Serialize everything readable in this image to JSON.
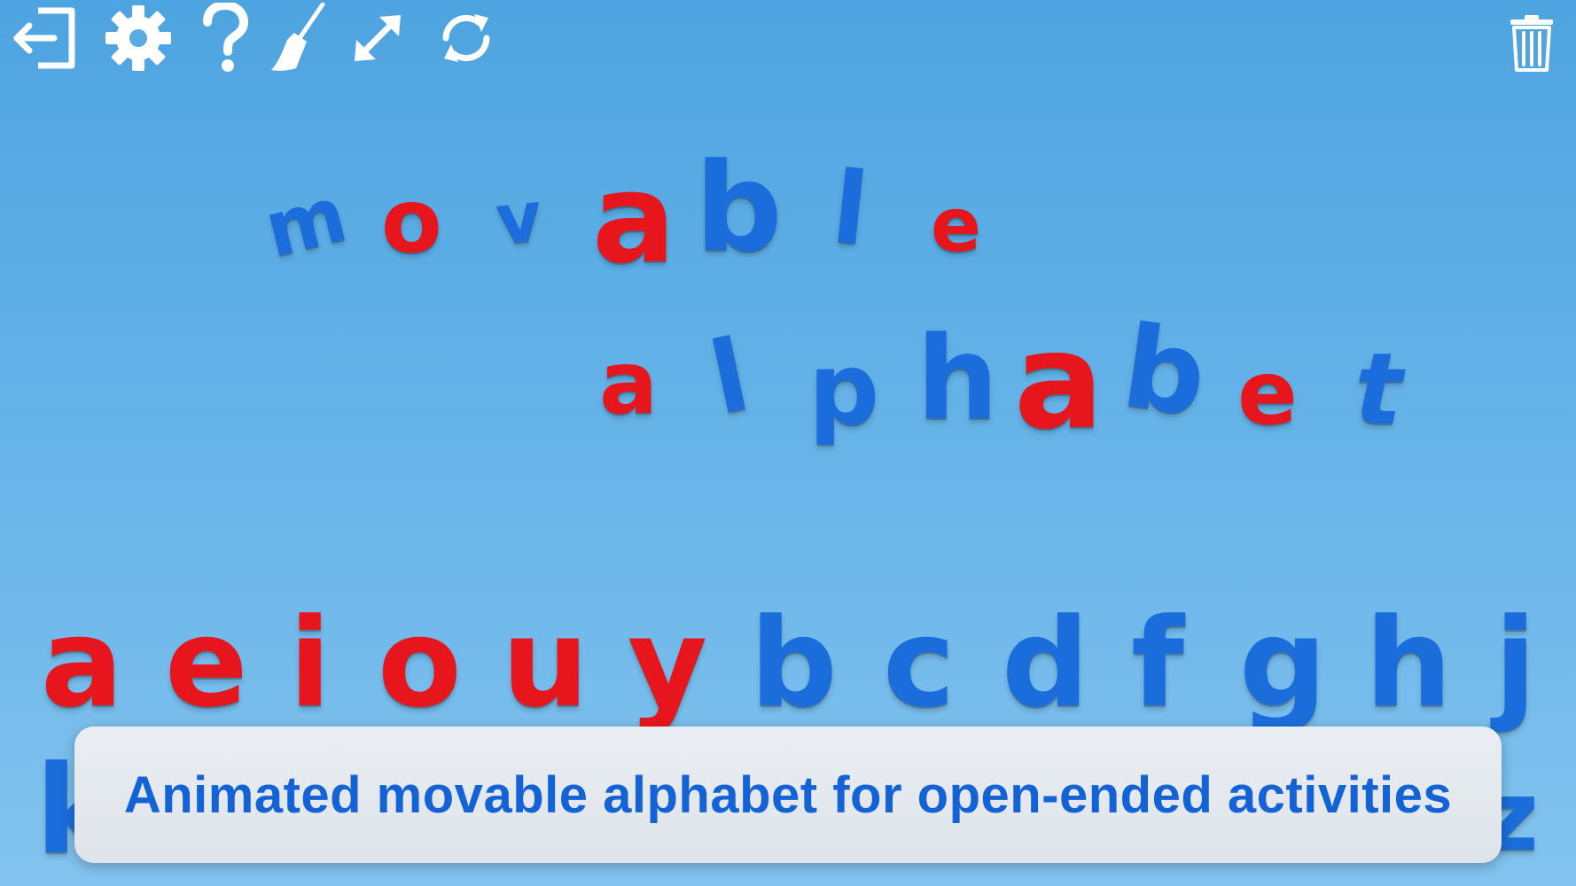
{
  "toolbar": {
    "left_icons": [
      "exit-icon",
      "gear-icon",
      "help-icon",
      "broom-icon",
      "resize-icon",
      "refresh-icon"
    ],
    "right_icons": [
      "trash-icon"
    ],
    "icon_color": "#ffffff"
  },
  "words": {
    "movable": [
      "m",
      "o",
      "v",
      "a",
      "b",
      "l",
      "e"
    ],
    "alphabet": [
      "a",
      "l",
      "p",
      "h",
      "a",
      "b",
      "e",
      "t"
    ]
  },
  "shelf": {
    "row1": [
      "a",
      "e",
      "i",
      "o",
      "u",
      "y",
      "b",
      "c",
      "d",
      "f",
      "g",
      "h",
      "j"
    ],
    "row2_visible": [
      "k",
      "z"
    ]
  },
  "caption": {
    "text": "Animated movable alphabet for open-ended activities"
  },
  "colors": {
    "vowel": "#e6161c",
    "consonant": "#1b6ddb",
    "caption_text": "#1463d6",
    "background": "#5aaae4"
  }
}
